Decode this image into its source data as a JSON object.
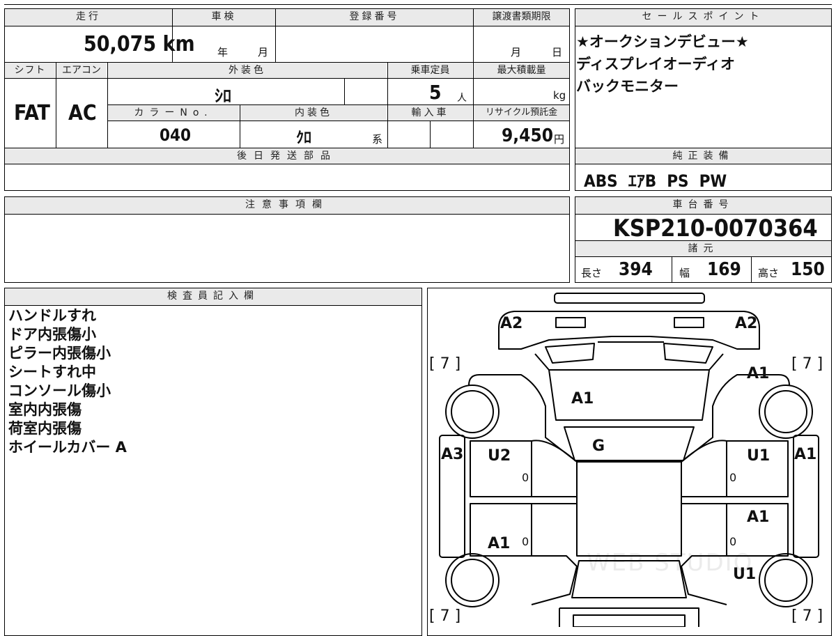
{
  "top_row": {
    "h_mileage": "走行",
    "h_shaken": "車検",
    "h_reg": "登録番号",
    "h_deadline": "譲渡書類期限",
    "mileage": "50,075 km",
    "shaken_year": "年",
    "shaken_month": "月",
    "deadline_month": "月",
    "deadline_day": "日"
  },
  "mid_row": {
    "h_shift": "シフト",
    "h_ac": "エアコン",
    "h_exterior": "外装色",
    "h_capacity": "乗車定員",
    "h_load": "最大積載量",
    "shift": "FAT",
    "ac": "AC",
    "exterior_color": "ｼﾛ",
    "capacity": "5",
    "capacity_unit": "人",
    "load_unit": "kg",
    "h_color_no": "カラーNo.",
    "h_interior": "内装色",
    "h_import": "輸入車",
    "h_recycle": "リサイクル預託金",
    "color_no": "040",
    "interior_color": "ｸﾛ",
    "interior_suffix": "系",
    "recycle_fee": "9,450",
    "recycle_unit": "円"
  },
  "later_parts": {
    "header": "後日発送部品",
    "value": ""
  },
  "sales_points": {
    "header": "セールスポイント",
    "lines": [
      "★オークションデビュー★",
      "ディスプレイオーディオ",
      "バックモニター"
    ]
  },
  "equipment": {
    "header": "純正装備",
    "value": "ABS  ｴｱB  PS  PW"
  },
  "notes": {
    "header": "注意事項欄",
    "value": ""
  },
  "chassis": {
    "header": "車台番号",
    "value": "KSP210-0070364"
  },
  "specs": {
    "header": "諸元",
    "length_label": "長さ",
    "length": "394",
    "width_label": "幅",
    "width": "169",
    "height_label": "高さ",
    "height": "150"
  },
  "inspector": {
    "header": "検査員記入欄",
    "lines": [
      "ハンドルすれ",
      "ドア内張傷小",
      "ピラー内張傷小",
      "シートすれ中",
      "コンソール傷小",
      "室内内張傷",
      "荷室内張傷",
      "ホイールカバー A"
    ]
  },
  "diagram": {
    "tl_a2": "A2",
    "tr_a2": "A2",
    "tl_7": "[ 7 ]",
    "tr_7": "[ 7 ]",
    "bl_7": "[ 7 ]",
    "br_7": "[ 7 ]",
    "front_right_a1": "A1",
    "windshield_a1": "A1",
    "roof_g": "G",
    "left_a3": "A3",
    "right_a1": "A1",
    "front_left_door_u2": "U2",
    "front_right_door_u1": "U1",
    "rear_left_a1": "A1",
    "rear_right_a1": "A1",
    "rear_right_u1": "U1",
    "zero_fl": "0",
    "zero_fr": "0",
    "zero_rl": "0",
    "zero_rr": "0",
    "watermark": "WEB STUDIO"
  }
}
